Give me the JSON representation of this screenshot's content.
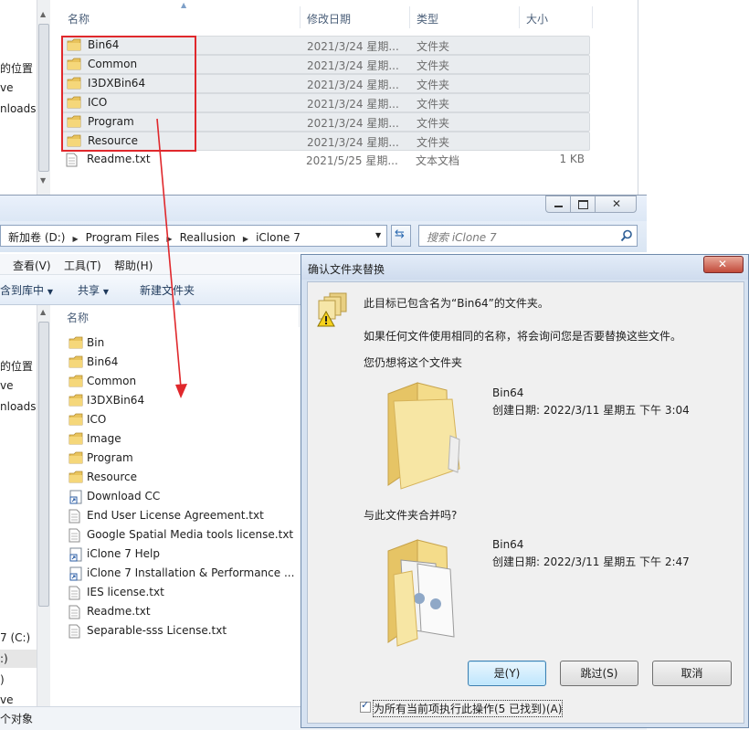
{
  "top_explorer": {
    "columns": {
      "name": "名称",
      "date": "修改日期",
      "type": "类型",
      "size": "大小"
    },
    "nav_fragments": [
      "的位置",
      "ve",
      "nloads"
    ],
    "rows": [
      {
        "name": "Bin64",
        "date": "2021/3/24 星期...",
        "type": "文件夹",
        "size": "",
        "icon": "folder-icon",
        "selected": true
      },
      {
        "name": "Common",
        "date": "2021/3/24 星期...",
        "type": "文件夹",
        "size": "",
        "icon": "folder-icon",
        "selected": true
      },
      {
        "name": "I3DXBin64",
        "date": "2021/3/24 星期...",
        "type": "文件夹",
        "size": "",
        "icon": "folder-icon",
        "selected": true
      },
      {
        "name": "ICO",
        "date": "2021/3/24 星期...",
        "type": "文件夹",
        "size": "",
        "icon": "folder-icon",
        "selected": true
      },
      {
        "name": "Program",
        "date": "2021/3/24 星期...",
        "type": "文件夹",
        "size": "",
        "icon": "folder-icon",
        "selected": true
      },
      {
        "name": "Resource",
        "date": "2021/3/24 星期...",
        "type": "文件夹",
        "size": "",
        "icon": "folder-icon",
        "selected": true
      },
      {
        "name": "Readme.txt",
        "date": "2021/5/25 星期...",
        "type": "文本文档",
        "size": "1 KB",
        "icon": "text-file-icon",
        "selected": false
      }
    ]
  },
  "bottom_explorer": {
    "breadcrumb": [
      "新加卷 (D:)",
      "Program Files",
      "Reallusion",
      "iClone 7"
    ],
    "search_placeholder": "搜索 iClone 7",
    "menu": [
      "查看(V)",
      "工具(T)",
      "帮助(H)"
    ],
    "toolbar": {
      "include": "含到库中",
      "share": "共享",
      "new_folder": "新建文件夹"
    },
    "column_name": "名称",
    "nav_fragments": [
      "的位置",
      "ve",
      "nloads",
      "7 (C:)",
      ":)",
      ")",
      "ve"
    ],
    "status": "个对象",
    "items": [
      {
        "name": "Bin",
        "icon": "folder-icon"
      },
      {
        "name": "Bin64",
        "icon": "folder-icon"
      },
      {
        "name": "Common",
        "icon": "folder-icon"
      },
      {
        "name": "I3DXBin64",
        "icon": "folder-icon"
      },
      {
        "name": "ICO",
        "icon": "folder-icon"
      },
      {
        "name": "Image",
        "icon": "folder-icon"
      },
      {
        "name": "Program",
        "icon": "folder-icon"
      },
      {
        "name": "Resource",
        "icon": "folder-icon"
      },
      {
        "name": "Download CC",
        "icon": "shortcut-icon"
      },
      {
        "name": "End User License Agreement.txt",
        "icon": "text-file-icon"
      },
      {
        "name": "Google Spatial Media tools license.txt",
        "icon": "text-file-icon"
      },
      {
        "name": "iClone 7 Help",
        "icon": "shortcut-icon"
      },
      {
        "name": "iClone 7 Installation & Performance ...",
        "icon": "shortcut-icon"
      },
      {
        "name": "IES license.txt",
        "icon": "text-file-icon"
      },
      {
        "name": "Readme.txt",
        "icon": "text-file-icon"
      },
      {
        "name": "Separable-sss License.txt",
        "icon": "text-file-icon"
      }
    ]
  },
  "dialog": {
    "title": "确认文件夹替换",
    "heading": "此目标已包含名为“Bin64”的文件夹。",
    "explain": "如果任何文件使用相同的名称，将会询问您是否要替换这些文件。",
    "question": "您仍想将这个文件夹",
    "existing": {
      "name": "Bin64",
      "created": "创建日期: 2022/3/11 星期五 下午 3:04"
    },
    "merge_question": "与此文件夹合并吗?",
    "incoming": {
      "name": "Bin64",
      "created": "创建日期: 2022/3/11 星期五 下午 2:47"
    },
    "buttons": {
      "yes": "是(Y)",
      "skip": "跳过(S)",
      "cancel": "取消"
    },
    "apply_all": "为所有当前项执行此操作(5 已找到)(A)",
    "apply_all_checked": true
  },
  "colors": {
    "annotation_red": "#e0282c",
    "selection": "#e9ecef",
    "link_blue": "#1e395b"
  }
}
